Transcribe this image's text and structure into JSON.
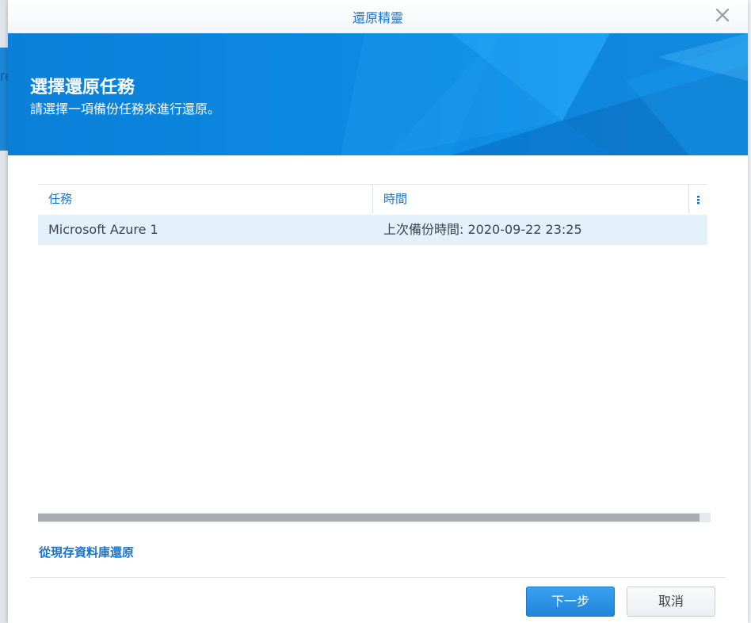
{
  "backdrop": {
    "left_text": "re"
  },
  "dialog": {
    "title": "還原精靈",
    "close_symbol": "×"
  },
  "banner": {
    "heading": "選擇還原任務",
    "subheading": "請選擇一項備份任務來進行還原。"
  },
  "grid": {
    "columns": [
      {
        "label": "任務"
      },
      {
        "label": "時間"
      }
    ],
    "menu_icon": "vertical-dots-icon",
    "rows": [
      {
        "task": "Microsoft Azure 1",
        "time": "上次備份時間: 2020-09-22 23:25",
        "selected": true
      }
    ]
  },
  "links": {
    "restore_from_db": "從現存資料庫還原"
  },
  "footer": {
    "next_label": "下一步",
    "cancel_label": "取消"
  },
  "colors": {
    "accent": "#1a75c9",
    "banner": "#0b86de",
    "selected_row": "#e3f1fb",
    "primary_button": "#2a8fe4"
  }
}
